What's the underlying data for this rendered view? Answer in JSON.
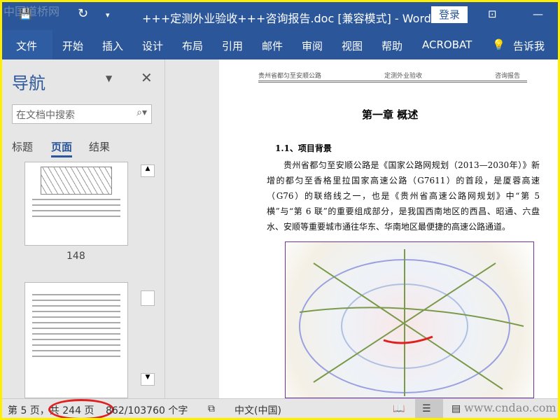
{
  "title_bar": {
    "title": "+++定测外业验收+++咨询报告.doc [兼容模式]  -  Word",
    "login": "登录",
    "watermark": "中国道桥网"
  },
  "ribbon": {
    "tabs": [
      "文件",
      "开始",
      "插入",
      "设计",
      "布局",
      "引用",
      "邮件",
      "审阅",
      "视图",
      "帮助",
      "ACROBAT"
    ],
    "tell_me": "告诉我"
  },
  "nav": {
    "title": "导航",
    "search_placeholder": "在文档中搜索",
    "tabs": [
      "标题",
      "页面",
      "结果"
    ],
    "active_tab": "页面",
    "thumb_page": "148"
  },
  "document": {
    "header_left": "贵州省都匀至安顺公路",
    "header_center": "定测外业验收",
    "header_right": "咨询报告",
    "chapter": "第一章 概述",
    "section": "1.1、项目背景",
    "paragraph": "贵州省都匀至安顺公路是《国家公路网规划（2013—2030年）》新增的都匀至香格里拉国家高速公路（G7611）的首段，是厦蓉高速（G76）的联络线之一，也是《贵州省高速公路网规划》中“第 5 横”与“第 6 联”的重要组成部分，是我国西南地区的西昌、昭通、六盘水、安顺等重要城市通往华东、华南地区最便捷的高速公路通道。"
  },
  "status": {
    "page": "第 5 页，共 244 页",
    "words": "862/103760 个字",
    "language": "中文(中国)",
    "watermark": "www.cndao.com"
  },
  "colors": {
    "accent": "#2b579a",
    "annotation": "#e02020"
  }
}
